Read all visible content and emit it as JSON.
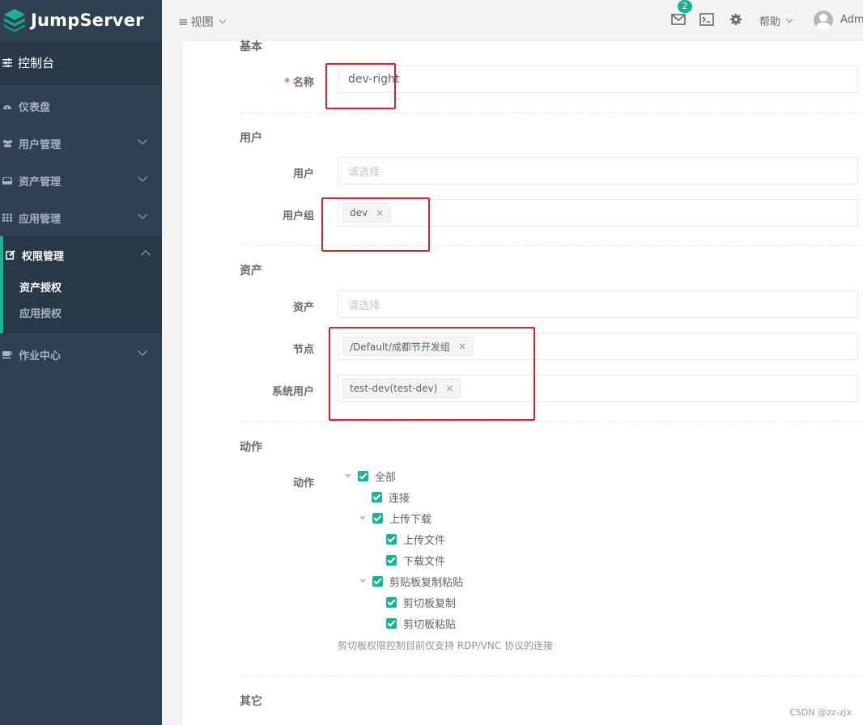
{
  "app": {
    "name": "JumpServer"
  },
  "sidebar": {
    "console": "控制台",
    "items": [
      {
        "label": "仪表盘"
      },
      {
        "label": "用户管理"
      },
      {
        "label": "资产管理"
      },
      {
        "label": "应用管理"
      },
      {
        "label": "权限管理"
      },
      {
        "label": "作业中心"
      }
    ],
    "sub_items": [
      {
        "label": "资产授权"
      },
      {
        "label": "应用授权"
      }
    ]
  },
  "header": {
    "view": "视图",
    "badge_count": "2",
    "help": "帮助",
    "user": "Adm"
  },
  "form": {
    "sections": {
      "basic": "基本",
      "user": "用户",
      "asset": "资产",
      "action": "动作",
      "other": "其它"
    },
    "name": {
      "label": "名称",
      "required_mark": "*",
      "value": "dev-right"
    },
    "users": {
      "label": "用户",
      "placeholder": "请选择"
    },
    "user_groups": {
      "label": "用户组",
      "tags": [
        "dev"
      ]
    },
    "assets": {
      "label": "资产",
      "placeholder": "请选择"
    },
    "nodes": {
      "label": "节点",
      "tags": [
        "/Default/成都节开发组"
      ]
    },
    "system_users": {
      "label": "系统用户",
      "tags": [
        "test-dev(test-dev)"
      ]
    },
    "actions": {
      "label": "动作",
      "tree": {
        "all": "全部",
        "connect": "连接",
        "transfer": "上传下载",
        "upload": "上传文件",
        "download": "下载文件",
        "clipboard": "剪贴板复制粘贴",
        "copy": "剪切板复制",
        "paste": "剪切板粘贴"
      },
      "hint": "剪切板权限控制目前仅支持 RDP/VNC 协议的连接"
    },
    "tag_close": "×"
  },
  "watermark": "CSDN @zz-zjx",
  "colors": {
    "sidebar_bg": "#2f4050",
    "accent": "#1ab394",
    "highlight": "#e51c23"
  }
}
